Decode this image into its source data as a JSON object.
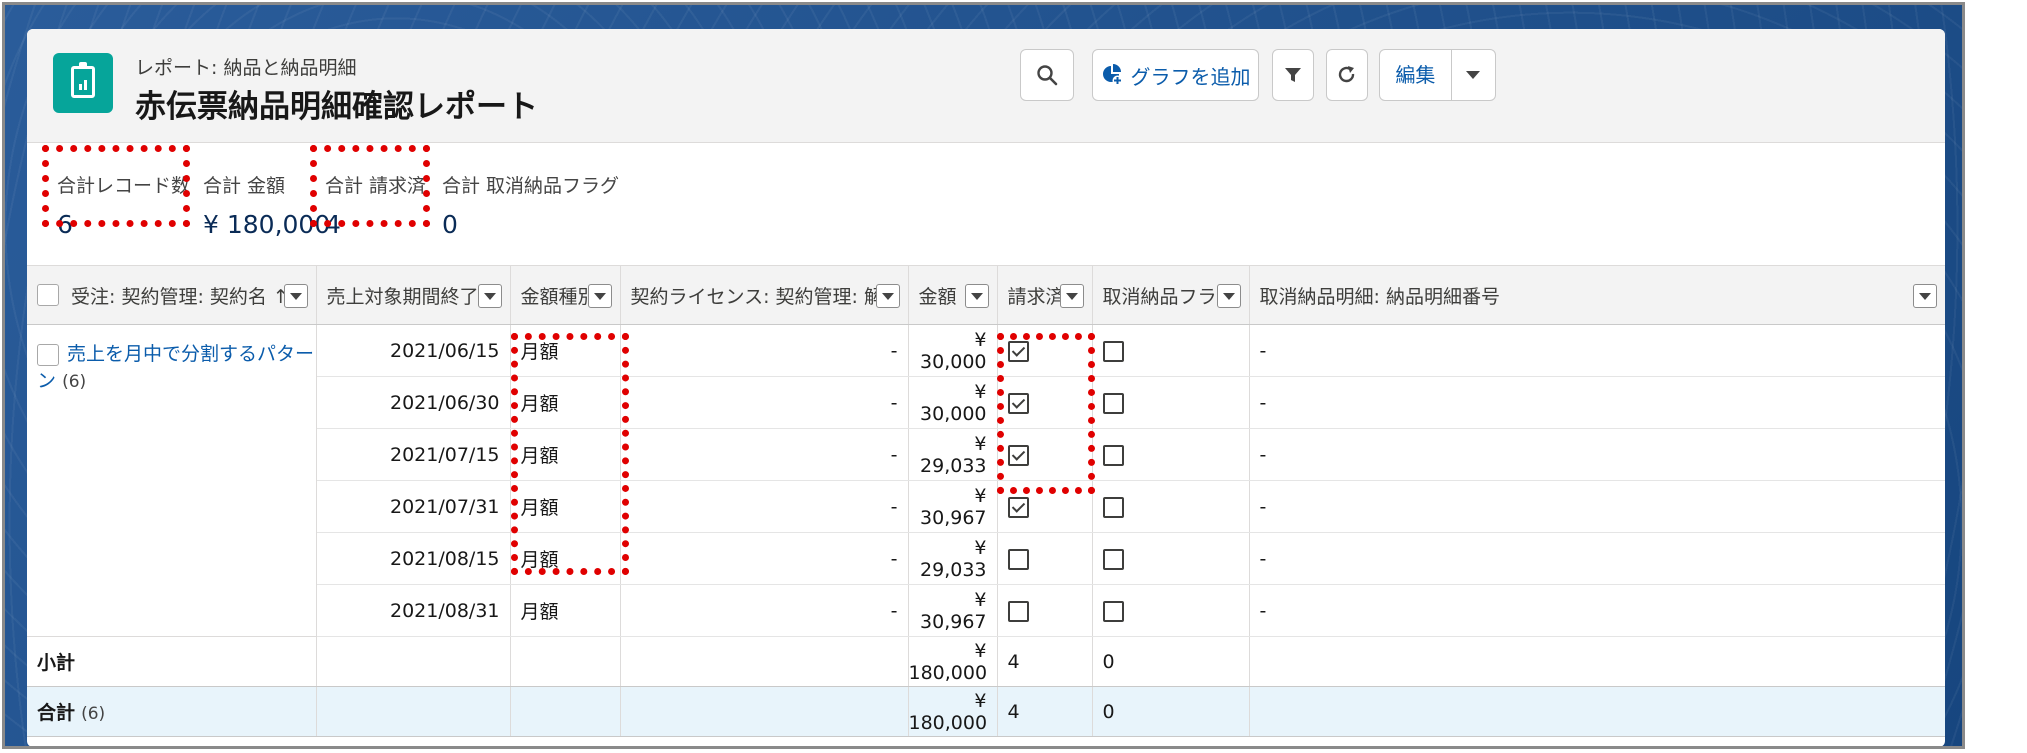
{
  "header": {
    "subtitle": "レポート: 納品と納品明細",
    "title": "赤伝票納品明細確認レポート",
    "add_chart_label": "グラフを追加",
    "edit_label": "編集"
  },
  "summary": [
    {
      "label": "合計レコード数",
      "value": "6"
    },
    {
      "label": "合計 金額",
      "value": "¥ 180,000"
    },
    {
      "label": "合計 請求済",
      "value": "4"
    },
    {
      "label": "合計 取消納品フラグ",
      "value": "0"
    }
  ],
  "columns": [
    "受注: 契約管理: 契約名 ↑",
    "売上対象期間終了 ↑",
    "金額種別",
    "契約ライセンス: 契約管理: 解約日",
    "金額",
    "請求済",
    "取消納品フラグ",
    "取消納品明細: 納品明細番号"
  ],
  "group": {
    "name": "売上を月中で分割するパターン",
    "count": "(6)"
  },
  "rows": [
    {
      "end_date": "2021/06/15",
      "amount_type": "月額",
      "cancel_date": "-",
      "amount": "¥ 30,000",
      "billed": true,
      "cancel_flag": false,
      "cancel_no": "-"
    },
    {
      "end_date": "2021/06/30",
      "amount_type": "月額",
      "cancel_date": "-",
      "amount": "¥ 30,000",
      "billed": true,
      "cancel_flag": false,
      "cancel_no": "-"
    },
    {
      "end_date": "2021/07/15",
      "amount_type": "月額",
      "cancel_date": "-",
      "amount": "¥ 29,033",
      "billed": true,
      "cancel_flag": false,
      "cancel_no": "-"
    },
    {
      "end_date": "2021/07/31",
      "amount_type": "月額",
      "cancel_date": "-",
      "amount": "¥ 30,967",
      "billed": true,
      "cancel_flag": false,
      "cancel_no": "-"
    },
    {
      "end_date": "2021/08/15",
      "amount_type": "月額",
      "cancel_date": "-",
      "amount": "¥ 29,033",
      "billed": false,
      "cancel_flag": false,
      "cancel_no": "-"
    },
    {
      "end_date": "2021/08/31",
      "amount_type": "月額",
      "cancel_date": "-",
      "amount": "¥ 30,967",
      "billed": false,
      "cancel_flag": false,
      "cancel_no": "-"
    }
  ],
  "subtotal": {
    "label": "小計",
    "amount": "¥ 180,000",
    "billed": "4",
    "cancel_flag": "0"
  },
  "total": {
    "label": "合計",
    "count": "(6)",
    "amount": "¥ 180,000",
    "billed": "4",
    "cancel_flag": "0"
  },
  "icons": {
    "report": "report-clipboard-icon",
    "search": "search-icon",
    "chart": "pie-chart-add-icon",
    "filter": "filter-icon",
    "refresh": "refresh-icon",
    "dropdown": "chevron-down-icon"
  },
  "colors": {
    "brand_teal": "#06a59a",
    "link_blue": "#0b5cab",
    "highlight_red": "#e00000",
    "total_row_bg": "#e8f4fb"
  }
}
